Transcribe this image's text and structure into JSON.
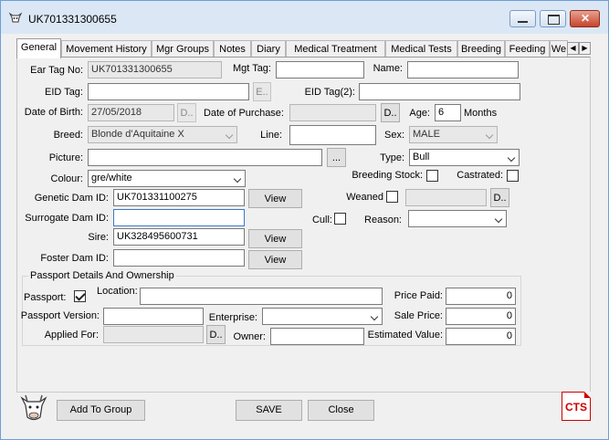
{
  "window": {
    "title": "UK701331300655",
    "controls": {
      "minimize_icon": "minimize-icon",
      "maximize_icon": "maximize-icon",
      "close_icon": "close-icon"
    }
  },
  "tabs": [
    {
      "label": "General",
      "active": true
    },
    {
      "label": "Movement History"
    },
    {
      "label": "Mgr Groups"
    },
    {
      "label": "Notes"
    },
    {
      "label": "Diary"
    },
    {
      "label": "Medical Treatment"
    },
    {
      "label": "Medical Tests"
    },
    {
      "label": "Breeding"
    },
    {
      "label": "Feeding"
    },
    {
      "label": "We"
    }
  ],
  "form": {
    "ear_tag_no": {
      "label": "Ear Tag No:",
      "value": "UK701331300655"
    },
    "mgt_tag": {
      "label": "Mgt Tag:",
      "value": ""
    },
    "name": {
      "label": "Name:",
      "value": ""
    },
    "eid_tag": {
      "label": "EID Tag:",
      "value": "",
      "button": "E.."
    },
    "eid_tag2": {
      "label": "EID Tag(2):",
      "value": ""
    },
    "date_of_birth": {
      "label": "Date of Birth:",
      "value": "27/05/2018",
      "button": "D.."
    },
    "date_of_purchase": {
      "label": "Date of Purchase:",
      "value": "",
      "button": "D.."
    },
    "age": {
      "label": "Age:",
      "value": "6",
      "unit": "Months"
    },
    "breed": {
      "label": "Breed:",
      "value": "Blonde d'Aquitaine X"
    },
    "line": {
      "label": "Line:",
      "value": ""
    },
    "sex": {
      "label": "Sex:",
      "value": "MALE"
    },
    "picture": {
      "label": "Picture:",
      "value": "",
      "button": "..."
    },
    "type": {
      "label": "Type:",
      "value": "Bull"
    },
    "colour": {
      "label": "Colour:",
      "value": "gre/white"
    },
    "breeding_stock": {
      "label": "Breeding Stock:",
      "checked": false
    },
    "castrated": {
      "label": "Castrated:",
      "checked": false
    },
    "genetic_dam_id": {
      "label": "Genetic Dam ID:",
      "value": "UK701331100275",
      "button": "View"
    },
    "weaned": {
      "label": "Weaned",
      "checked": false,
      "value": "",
      "button": "D.."
    },
    "surrogate_dam_id": {
      "label": "Surrogate Dam ID:",
      "value": ""
    },
    "cull": {
      "label": "Cull:",
      "checked": false
    },
    "reason": {
      "label": "Reason:",
      "value": ""
    },
    "sire": {
      "label": "Sire:",
      "value": "UK328495600731",
      "button": "View"
    },
    "foster_dam_id": {
      "label": "Foster Dam ID:",
      "value": "",
      "button": "View"
    }
  },
  "passport": {
    "group_title": "Passport Details And Ownership",
    "passport": {
      "label": "Passport:",
      "checked": true
    },
    "location": {
      "label": "Location:",
      "value": ""
    },
    "price_paid": {
      "label": "Price Paid:",
      "value": "0"
    },
    "passport_version": {
      "label": "Passport Version:",
      "value": ""
    },
    "enterprise": {
      "label": "Enterprise:",
      "value": ""
    },
    "sale_price": {
      "label": "Sale Price:",
      "value": "0"
    },
    "applied_for": {
      "label": "Applied For:",
      "value": "",
      "button": "D.."
    },
    "owner": {
      "label": "Owner:",
      "value": ""
    },
    "estimated_value": {
      "label": "Estimated Value:",
      "value": "0"
    }
  },
  "footer": {
    "add_to_group": "Add To Group",
    "save": "SAVE",
    "close": "Close",
    "logo_text": "CTS",
    "cow_icon": "cow-icon"
  }
}
